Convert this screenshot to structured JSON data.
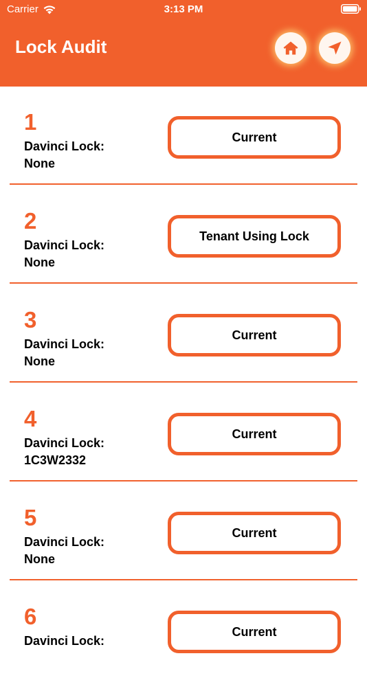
{
  "status_bar": {
    "carrier": "Carrier",
    "time": "3:13 PM"
  },
  "header": {
    "title": "Lock Audit",
    "home_icon": "home-icon",
    "send_icon": "paper-plane-icon"
  },
  "colors": {
    "accent": "#f1602c",
    "button_bg": "#fff6ef",
    "glow": "#ffd678"
  },
  "rows": [
    {
      "number": "1",
      "label": "Davinci Lock:",
      "value": "None",
      "status": "Current"
    },
    {
      "number": "2",
      "label": "Davinci Lock:",
      "value": "None",
      "status": "Tenant Using Lock"
    },
    {
      "number": "3",
      "label": "Davinci Lock:",
      "value": "None",
      "status": "Current"
    },
    {
      "number": "4",
      "label": "Davinci Lock:",
      "value": "1C3W2332",
      "status": "Current"
    },
    {
      "number": "5",
      "label": "Davinci Lock:",
      "value": "None",
      "status": "Current"
    },
    {
      "number": "6",
      "label": "Davinci Lock:",
      "value": "",
      "status": "Current"
    }
  ]
}
